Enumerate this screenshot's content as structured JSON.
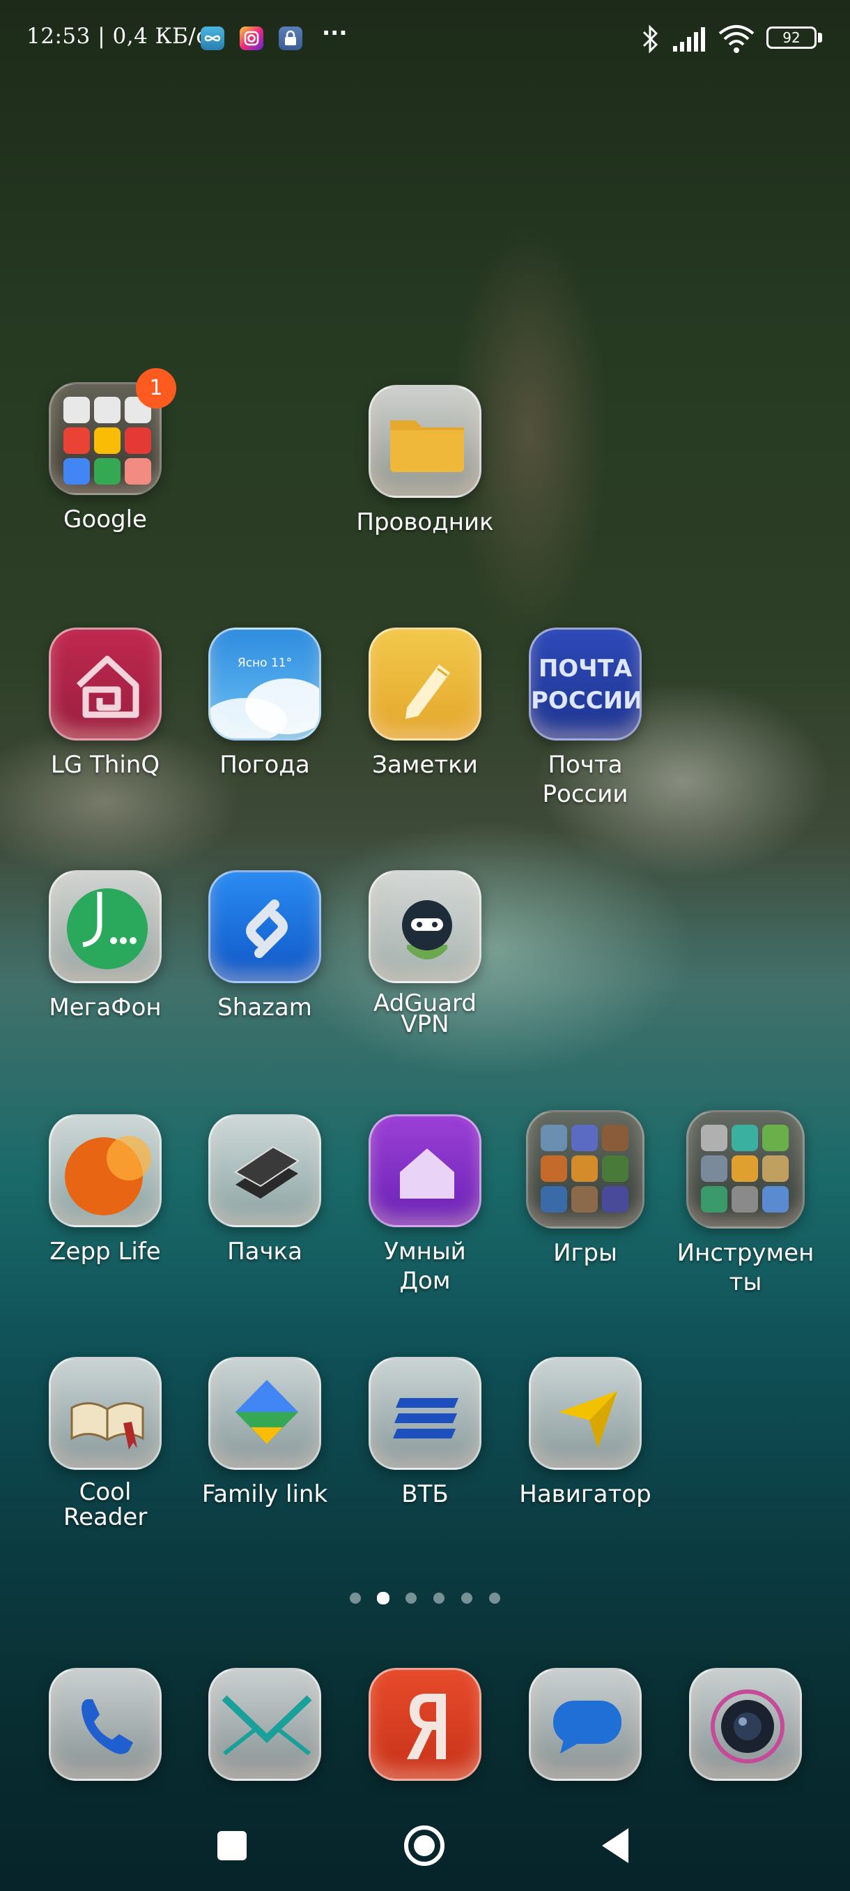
{
  "status_bar": {
    "time_speed": "12:53 | 0,4 КБ/с",
    "more": "···",
    "battery": "92"
  },
  "apps": {
    "google": {
      "label": "Google",
      "badge": "1"
    },
    "files": {
      "label": "Проводник"
    },
    "lg": {
      "label": "LG ThinQ"
    },
    "weather": {
      "label": "Погода",
      "icon_text": "Ясно 11°"
    },
    "notes": {
      "label": "Заметки"
    },
    "post": {
      "label": "Почта России",
      "icon_text_1": "ПОЧТА",
      "icon_text_2": "РОССИИ"
    },
    "megafon": {
      "label": "МегаФон"
    },
    "shazam": {
      "label": "Shazam"
    },
    "adguard": {
      "label": "AdGuard VPN"
    },
    "zepp": {
      "label": "Zepp Life"
    },
    "pachka": {
      "label": "Пачка"
    },
    "smarthome": {
      "label": "Умный Дом"
    },
    "games": {
      "label": "Игры"
    },
    "tools": {
      "label": "Инструмен ты"
    },
    "coolreader": {
      "label": "Cool Reader"
    },
    "familylink": {
      "label": "Family link"
    },
    "vtb": {
      "label": "ВТБ"
    },
    "navigator": {
      "label": "Навигатор"
    }
  },
  "page_indicator": {
    "count": 6,
    "active": 1
  },
  "dock": [
    "phone-icon",
    "mail-icon",
    "yandex-browser-icon",
    "messages-icon",
    "camera-icon"
  ],
  "colors": {
    "badge": "#ff5a1f",
    "accent_orange": "#ff5a1f"
  }
}
